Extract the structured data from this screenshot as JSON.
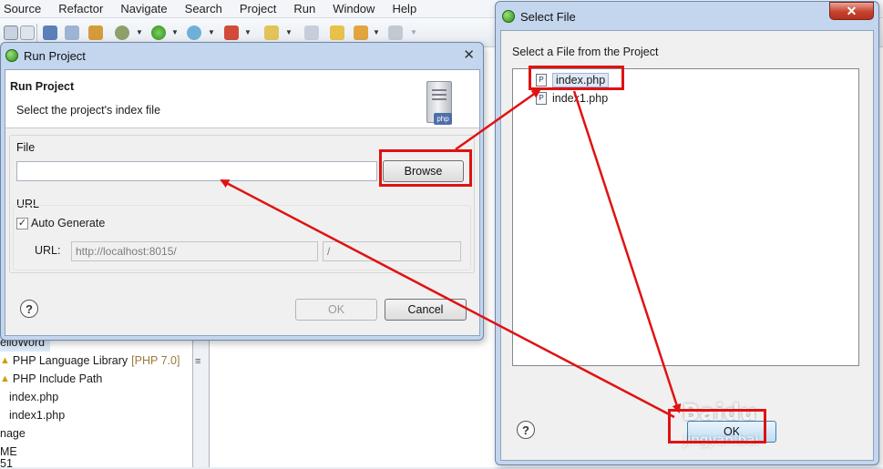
{
  "menubar": {
    "items": [
      "Source",
      "Refactor",
      "Navigate",
      "Search",
      "Project",
      "Run",
      "Window",
      "Help"
    ]
  },
  "project_tree": {
    "root_fragment": "elloWord",
    "items": [
      {
        "label": "PHP Language Library",
        "suffix": "[PHP 7.0]",
        "icon": "warning-icon"
      },
      {
        "label": "PHP Include Path",
        "suffix": "",
        "icon": "warning-icon"
      },
      {
        "label": "index.php",
        "suffix": "",
        "icon": ""
      },
      {
        "label": "index1.php",
        "suffix": "",
        "icon": ""
      },
      {
        "label": "nage",
        "suffix": "",
        "icon": ""
      },
      {
        "label": "ME",
        "suffix": "",
        "icon": ""
      },
      {
        "label": "51",
        "suffix": "",
        "icon": ""
      }
    ]
  },
  "run_dialog": {
    "window_title": "Run Project",
    "header_title": "Run Project",
    "header_subtitle": "Select the project's index file",
    "php_badge": "php",
    "file_group_label": "File",
    "file_value": "",
    "browse_label": "Browse",
    "url_group_label": "URL",
    "auto_generate_label": "Auto Generate",
    "auto_generate_checked": true,
    "url_label": "URL:",
    "url_base": "http://localhost:8015/",
    "url_path": "/",
    "ok_label": "OK",
    "cancel_label": "Cancel",
    "help_symbol": "?",
    "close_symbol": "✕"
  },
  "select_dialog": {
    "window_title": "Select File",
    "prompt": "Select a File from the Project",
    "files": [
      {
        "name": "index.php",
        "selected": true
      },
      {
        "name": "index1.php",
        "selected": false
      }
    ],
    "file_icon_letter": "P",
    "ok_label": "OK",
    "help_symbol": "?",
    "close_symbol": "✕"
  },
  "watermark": {
    "brand": "Baidu",
    "sub": "jingyan.bai"
  },
  "colors": {
    "annotation_red": "#e01212",
    "title_bar": "#c3d6ee",
    "close_red": "#c7432f"
  }
}
